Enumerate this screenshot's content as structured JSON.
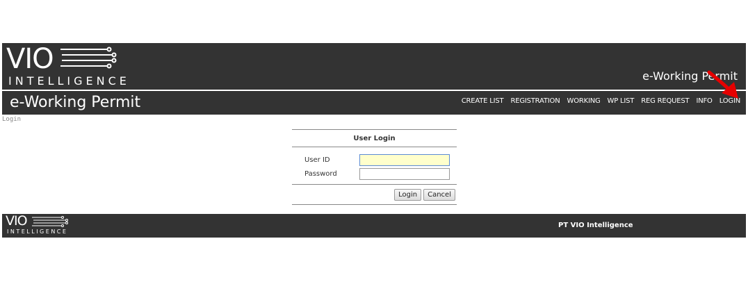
{
  "header": {
    "logo_main": "VIO",
    "logo_sub": "INTELLIGENCE",
    "brand_right": "e-Working Permit",
    "app_title": "e-Working Permit"
  },
  "nav": {
    "items": [
      {
        "label": "CREATE LIST"
      },
      {
        "label": "REGISTRATION"
      },
      {
        "label": "WORKING"
      },
      {
        "label": "WP LIST"
      },
      {
        "label": "REG REQUEST"
      },
      {
        "label": "INFO"
      },
      {
        "label": "LOGIN"
      }
    ]
  },
  "breadcrumb": "Login",
  "login": {
    "title": "User Login",
    "user_id_label": "User ID",
    "user_id_value": "",
    "password_label": "Password",
    "password_value": "",
    "login_button": "Login",
    "cancel_button": "Cancel"
  },
  "footer": {
    "logo_main": "VIO",
    "logo_sub": "INTELLIGENCE",
    "company": "PT VIO Intelligence"
  },
  "colors": {
    "header_bg": "#333333",
    "highlight_input": "#ffffcc",
    "arrow": "#e60000"
  }
}
